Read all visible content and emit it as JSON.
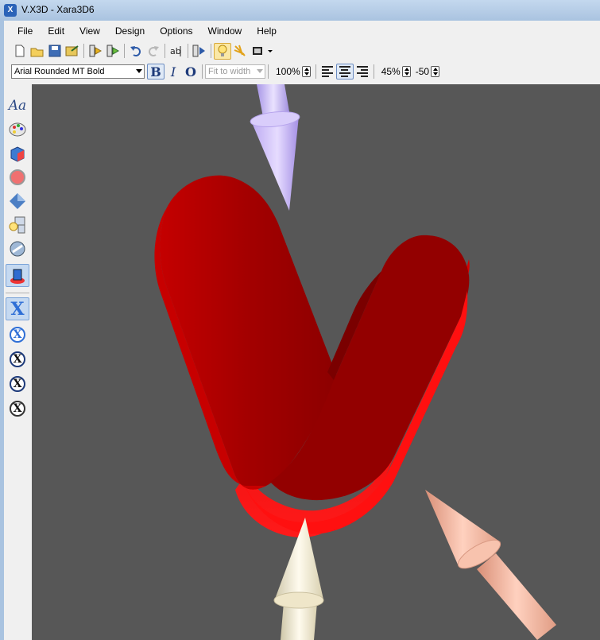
{
  "window": {
    "title": "V.X3D - Xara3D6"
  },
  "menu": [
    "File",
    "Edit",
    "View",
    "Design",
    "Options",
    "Window",
    "Help"
  ],
  "toolbar": {
    "icons": [
      "new-icon",
      "open-icon",
      "save-icon",
      "export-icon",
      "animation-icon",
      "animation-export-icon",
      "undo-icon",
      "redo-icon",
      "text-edit-icon",
      "play-icon",
      "light-bulb-icon",
      "lights-icon",
      "frame-icon"
    ]
  },
  "format": {
    "font": "Arial Rounded MT Bold",
    "bold_label": "B",
    "italic_label": "I",
    "outline_label": "O",
    "fit_mode": "Fit to width",
    "zoom": "100%",
    "opacity": "45%",
    "offset": "-50"
  },
  "sidebar": {
    "text_tool_label": "Aa",
    "tools": [
      "text-style-icon",
      "color-palette-icon",
      "extrude-icon",
      "shade-icon",
      "bevel-icon",
      "lighting-icon",
      "animation-icon",
      "view-icon"
    ],
    "x_variants": [
      "X",
      "X",
      "X",
      "X",
      "X"
    ]
  },
  "colors": {
    "letter": "#b30000",
    "letter_dark": "#8e0000",
    "letter_bright": "#ff1212",
    "viewport": "#575757",
    "arrow_purple": "#c7b6f5",
    "arrow_cream": "#f7f1dc",
    "arrow_peach": "#f2b7a2"
  }
}
